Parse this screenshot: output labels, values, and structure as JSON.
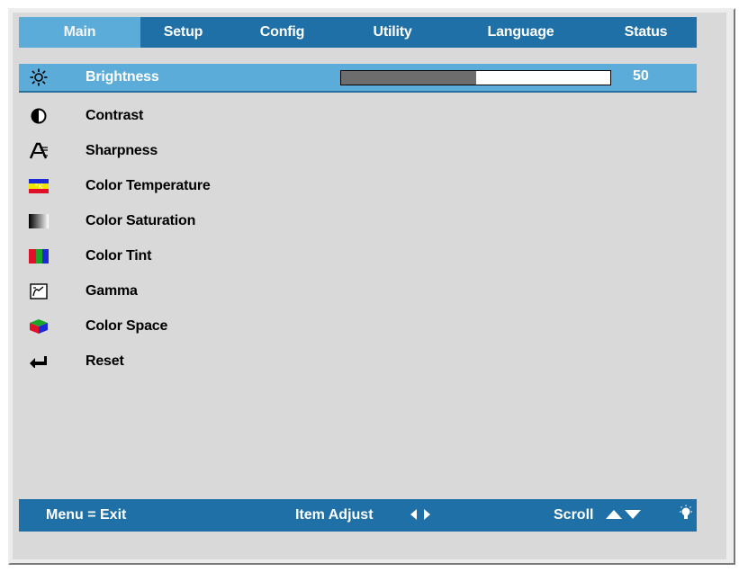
{
  "tabs": [
    {
      "label": "Main",
      "active": true
    },
    {
      "label": "Setup",
      "active": false
    },
    {
      "label": "Config",
      "active": false
    },
    {
      "label": "Utility",
      "active": false
    },
    {
      "label": "Language",
      "active": false
    },
    {
      "label": "Status",
      "active": false
    }
  ],
  "menu": {
    "items": [
      {
        "label": "Brightness",
        "icon": "sun-icon"
      },
      {
        "label": "Contrast",
        "icon": "contrast-icon"
      },
      {
        "label": "Sharpness",
        "icon": "sharpness-icon"
      },
      {
        "label": "Color Temperature",
        "icon": "color-temperature-icon"
      },
      {
        "label": "Color Saturation",
        "icon": "color-saturation-icon"
      },
      {
        "label": "Color Tint",
        "icon": "color-tint-icon"
      },
      {
        "label": "Gamma",
        "icon": "gamma-icon"
      },
      {
        "label": "Color Space",
        "icon": "color-space-icon"
      },
      {
        "label": "Reset",
        "icon": "reset-icon"
      }
    ],
    "selected_index": 0
  },
  "brightness": {
    "value": "50",
    "fraction": 0.5
  },
  "footer": {
    "menu_exit": "Menu = Exit",
    "item_adjust": "Item Adjust",
    "scroll": "Scroll"
  },
  "colors": {
    "bar": "#1f70a6",
    "highlight": "#5cacd9",
    "panel": "#d9d9d9"
  }
}
